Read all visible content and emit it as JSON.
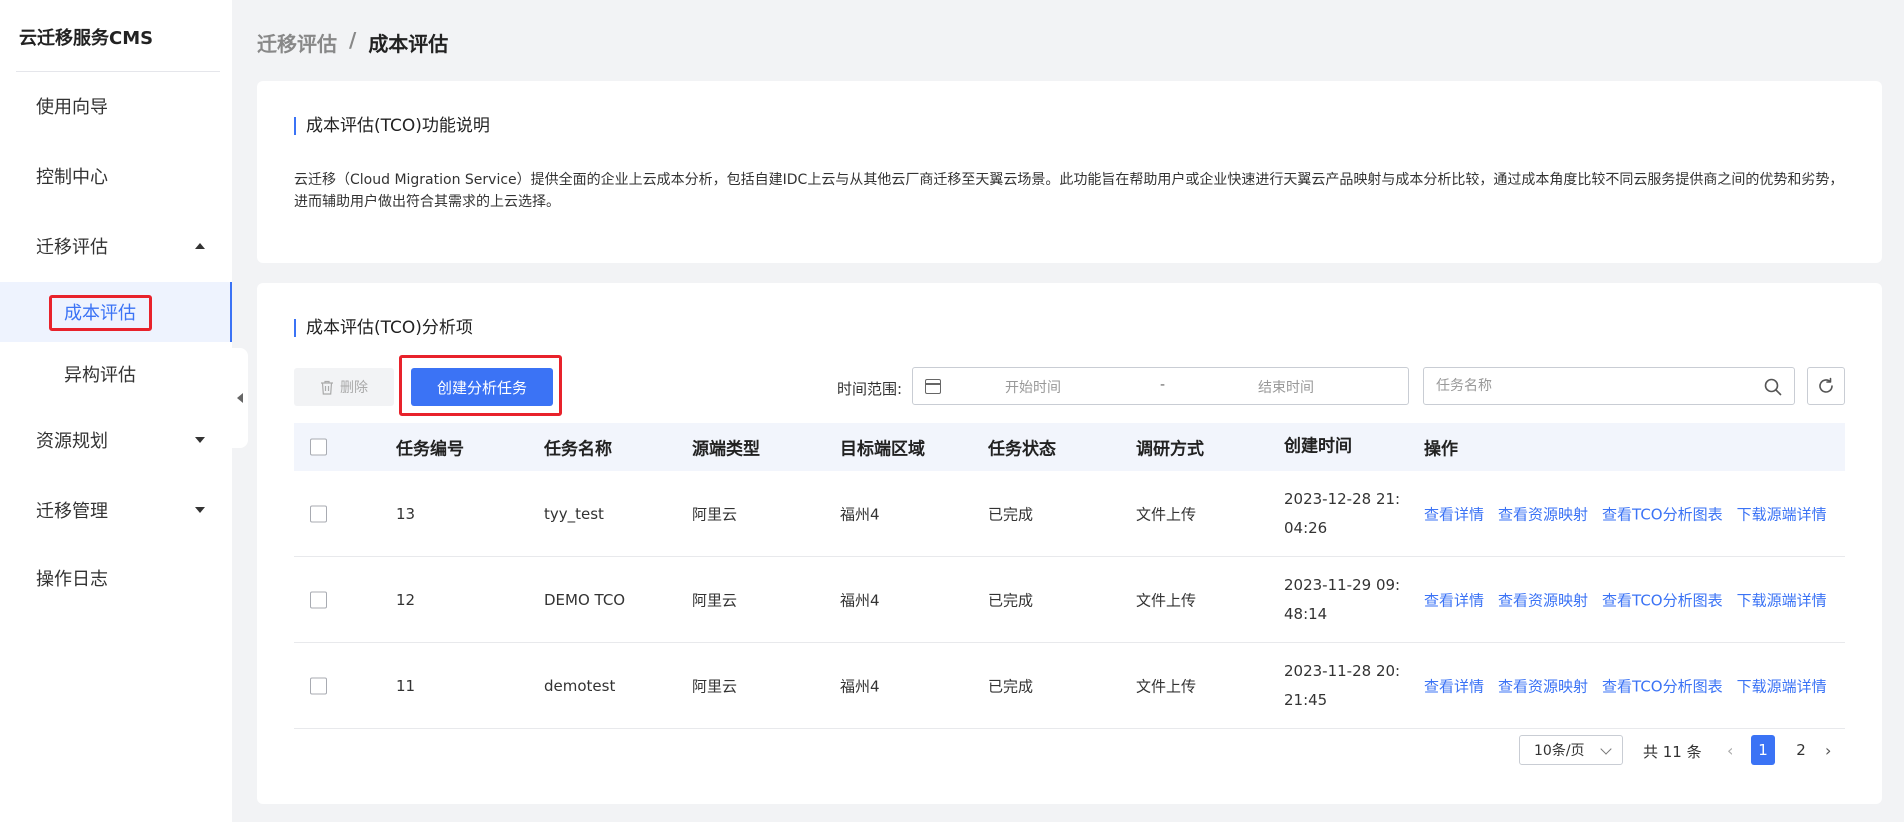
{
  "sidebar": {
    "brand": "云迁移服务CMS",
    "items": [
      {
        "label": "使用向导"
      },
      {
        "label": "控制中心"
      },
      {
        "label": "迁移评估"
      },
      {
        "label": "资源规划"
      },
      {
        "label": "迁移管理"
      },
      {
        "label": "操作日志"
      }
    ],
    "sub_items": [
      {
        "label": "成本评估"
      },
      {
        "label": "异构评估"
      }
    ]
  },
  "breadcrumb": {
    "parent": "迁移评估",
    "separator": "/",
    "current": "成本评估"
  },
  "intro": {
    "title": "成本评估(TCO)功能说明",
    "description": "云迁移（Cloud Migration Service）提供全面的企业上云成本分析，包括自建IDC上云与从其他云厂商迁移至天翼云场景。此功能旨在帮助用户或企业快速进行天翼云产品映射与成本分析比较，通过成本角度比较不同云服务提供商之间的优势和劣势，进而辅助用户做出符合其需求的上云选择。"
  },
  "analysis": {
    "title": "成本评估(TCO)分析项",
    "delete_label": "删除",
    "create_label": "创建分析任务",
    "range_label": "时间范围:",
    "start_placeholder": "开始时间",
    "range_dash": "-",
    "end_placeholder": "结束时间",
    "search_placeholder": "任务名称"
  },
  "table": {
    "headers": {
      "id": "任务编号",
      "name": "任务名称",
      "source": "源端类型",
      "region": "目标端区域",
      "status": "任务状态",
      "method": "调研方式",
      "created": "创建时间",
      "ops": "操作"
    },
    "ops": {
      "detail": "查看详情",
      "mapping": "查看资源映射",
      "chart": "查看TCO分析图表",
      "download": "下载源端详情"
    },
    "rows": [
      {
        "id": "13",
        "name": "tyy_test",
        "source": "阿里云",
        "region": "福州4",
        "status": "已完成",
        "method": "文件上传",
        "created": "2023-12-28 21:04:26"
      },
      {
        "id": "12",
        "name": "DEMO TCO",
        "source": "阿里云",
        "region": "福州4",
        "status": "已完成",
        "method": "文件上传",
        "created": "2023-11-29 09:48:14"
      },
      {
        "id": "11",
        "name": "demotest",
        "source": "阿里云",
        "region": "福州4",
        "status": "已完成",
        "method": "文件上传",
        "created": "2023-11-28 20:21:45"
      }
    ]
  },
  "pagination": {
    "page_size": "10条/页",
    "total": "共 11 条",
    "prev": "‹",
    "next": "›",
    "pages": [
      "1",
      "2"
    ],
    "current": "1"
  },
  "colors": {
    "accent": "#3b73f5",
    "highlight": "#e8222b"
  }
}
